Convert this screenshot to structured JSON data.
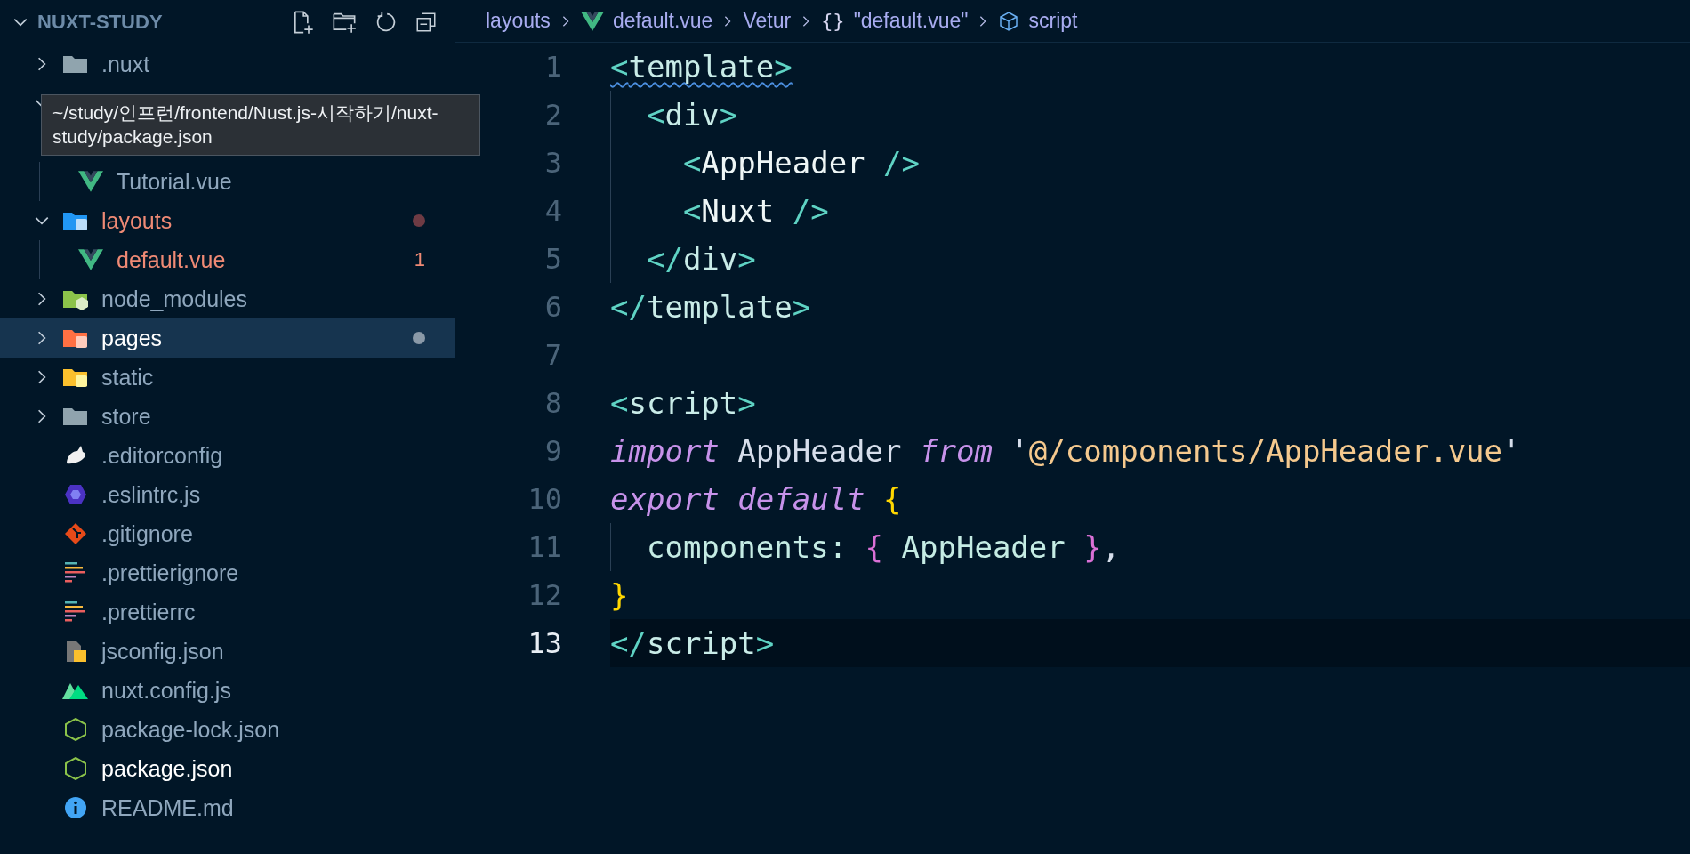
{
  "explorer": {
    "title": "NUXT-STUDY",
    "expanded": true,
    "toolbar": [
      {
        "kind": "new_file"
      },
      {
        "kind": "new_folder"
      },
      {
        "kind": "refresh"
      },
      {
        "kind": "collapse"
      }
    ],
    "tooltip": "~/study/인프런/frontend/Nust.js-시작하기/nuxt-study/package.json",
    "items": [
      {
        "kind": "plain_folder",
        "name": ".nuxt",
        "expanded": false,
        "selected": false,
        "hovered": false,
        "error": false
      },
      {
        "kind": "plain_folder",
        "expanded": true,
        "selected": false,
        "children": [
          {
            "kind": "vue_file",
            "name": "Tutorial.vue",
            "selected": false,
            "hovered": false,
            "error": false
          }
        ]
      },
      {
        "kind": "layout_folder",
        "name": "layouts",
        "expanded": true,
        "selected": false,
        "hovered": false,
        "error": true,
        "marker": {
          "kind": "dot",
          "color": "#6e3b44"
        },
        "children": [
          {
            "kind": "vue_file",
            "name": "default.vue",
            "selected": false,
            "hovered": false,
            "error": true,
            "marker": {
              "kind": "count",
              "text": "1"
            }
          }
        ]
      },
      {
        "kind": "node_folder",
        "name": "node_modules",
        "expanded": false,
        "selected": false,
        "hovered": false,
        "error": false
      },
      {
        "kind": "pages_folder",
        "name": "pages",
        "expanded": false,
        "selected": true,
        "hovered": false,
        "error": false,
        "marker": {
          "kind": "dot",
          "color": "#8a99a8"
        }
      },
      {
        "kind": "static_folder",
        "name": "static",
        "expanded": false,
        "selected": false,
        "hovered": false,
        "error": false
      },
      {
        "kind": "plain_folder",
        "name": "store",
        "expanded": false,
        "selected": false,
        "hovered": false,
        "error": false
      },
      {
        "kind": "editorconfig_file",
        "name": ".editorconfig",
        "selected": false,
        "hovered": false,
        "error": false
      },
      {
        "kind": "eslint_file",
        "name": ".eslintrc.js",
        "selected": false,
        "hovered": false,
        "error": false
      },
      {
        "kind": "git_file",
        "name": ".gitignore",
        "selected": false,
        "hovered": false,
        "error": false
      },
      {
        "kind": "prettier_file",
        "name": ".prettierignore",
        "selected": false,
        "hovered": false,
        "error": false
      },
      {
        "kind": "prettier_file",
        "name": ".prettierrc",
        "selected": false,
        "hovered": false,
        "error": false
      },
      {
        "kind": "jsconfig_file",
        "name": "jsconfig.json",
        "selected": false,
        "hovered": false,
        "error": false
      },
      {
        "kind": "nuxt_file",
        "name": "nuxt.config.js",
        "selected": false,
        "hovered": false,
        "error": false
      },
      {
        "kind": "node_file",
        "name": "package-lock.json",
        "selected": false,
        "hovered": false,
        "error": false
      },
      {
        "kind": "node_file",
        "name": "package.json",
        "selected": false,
        "hovered": true,
        "error": false
      },
      {
        "kind": "info_file",
        "name": "README.md",
        "selected": false,
        "hovered": false,
        "error": false
      }
    ]
  },
  "breadcrumb": [
    {
      "kind": "text",
      "text": "layouts"
    },
    {
      "kind": "vue",
      "text": "default.vue"
    },
    {
      "kind": "text",
      "text": "Vetur"
    },
    {
      "kind": "braces",
      "glyph": "{}",
      "text": "\"default.vue\""
    },
    {
      "kind": "cube",
      "text": "script"
    }
  ],
  "editor": {
    "lines": [
      {
        "number": "1",
        "current": false,
        "problem": true,
        "tokens": [
          {
            "kind": "bracket",
            "text": "<"
          },
          {
            "kind": "tag",
            "text": "template"
          },
          {
            "kind": "bracket",
            "text": ">"
          }
        ]
      },
      {
        "number": "2",
        "current": false,
        "problem": false,
        "tokens": [
          {
            "kind": "bracket",
            "text": "  <"
          },
          {
            "kind": "tag",
            "text": "div"
          },
          {
            "kind": "bracket",
            "text": ">"
          }
        ]
      },
      {
        "number": "3",
        "current": false,
        "problem": false,
        "tokens": [
          {
            "kind": "bracket",
            "text": "    <"
          },
          {
            "kind": "component",
            "text": "AppHeader"
          },
          {
            "kind": "bracket",
            "text": " />"
          }
        ]
      },
      {
        "number": "4",
        "current": false,
        "problem": false,
        "tokens": [
          {
            "kind": "bracket",
            "text": "    <"
          },
          {
            "kind": "component",
            "text": "Nuxt"
          },
          {
            "kind": "bracket",
            "text": " />"
          }
        ]
      },
      {
        "number": "5",
        "current": false,
        "problem": false,
        "tokens": [
          {
            "kind": "bracket",
            "text": "  </"
          },
          {
            "kind": "tag",
            "text": "div"
          },
          {
            "kind": "bracket",
            "text": ">"
          }
        ]
      },
      {
        "number": "6",
        "current": false,
        "problem": false,
        "tokens": [
          {
            "kind": "bracket",
            "text": "</"
          },
          {
            "kind": "tag",
            "text": "template"
          },
          {
            "kind": "bracket",
            "text": ">"
          }
        ]
      },
      {
        "number": "7",
        "current": false,
        "problem": false
      },
      {
        "number": "8",
        "current": false,
        "problem": false,
        "tokens": [
          {
            "kind": "bracket",
            "text": "<"
          },
          {
            "kind": "tag",
            "text": "script"
          },
          {
            "kind": "bracket",
            "text": ">"
          }
        ]
      },
      {
        "number": "9",
        "current": false,
        "problem": false,
        "tokens": [
          {
            "kind": "keyword",
            "text": "import"
          },
          {
            "kind": "ident",
            "text": " AppHeader "
          },
          {
            "kind": "keyword",
            "text": "from"
          },
          {
            "kind": "ident",
            "text": " '"
          },
          {
            "kind": "string",
            "text": "@/components/AppHeader.vue"
          },
          {
            "kind": "ident",
            "text": "'"
          }
        ]
      },
      {
        "number": "10",
        "current": false,
        "problem": false,
        "tokens": [
          {
            "kind": "keyword",
            "text": "export default"
          },
          {
            "kind": "brace1",
            "text": " {"
          }
        ]
      },
      {
        "number": "11",
        "current": false,
        "problem": false,
        "tokens": [
          {
            "kind": "prop",
            "text": "  components:"
          },
          {
            "kind": "brace2",
            "text": " {"
          },
          {
            "kind": "prop",
            "text": " AppHeader "
          },
          {
            "kind": "brace2",
            "text": "}"
          },
          {
            "kind": "ident",
            "text": ","
          }
        ]
      },
      {
        "number": "12",
        "current": false,
        "problem": false,
        "tokens": [
          {
            "kind": "brace1",
            "text": "}"
          }
        ]
      },
      {
        "number": "13",
        "current": true,
        "problem": false,
        "tokens": [
          {
            "kind": "bracket",
            "text": "</"
          },
          {
            "kind": "tag",
            "text": "script"
          },
          {
            "kind": "bracket",
            "text": ">"
          }
        ]
      }
    ]
  }
}
